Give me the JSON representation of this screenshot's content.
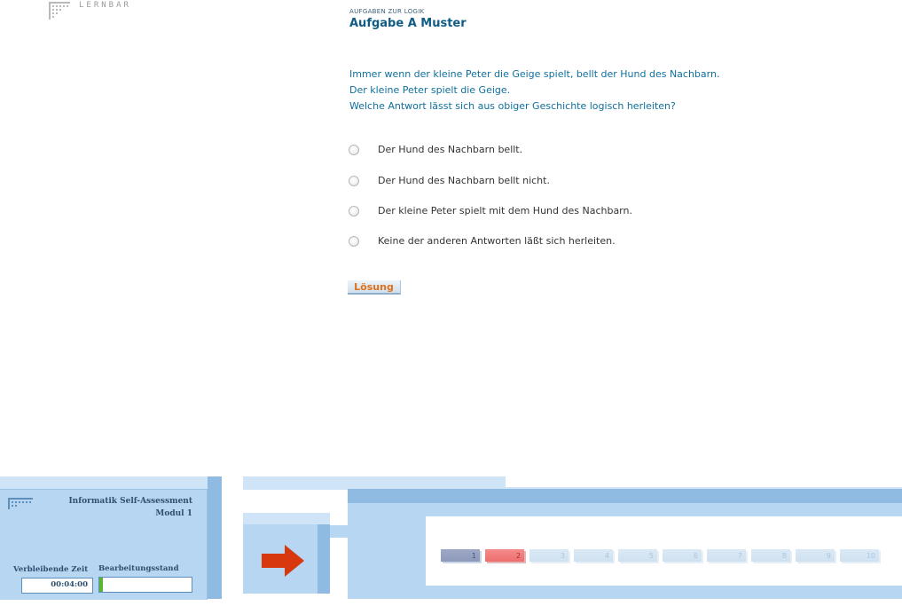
{
  "logo": {
    "text": "LERNBAR",
    "icon": "dot-matrix-logo-icon"
  },
  "task": {
    "kicker": "AUFGABEN ZUR LOGIK",
    "title": "Aufgabe A Muster",
    "prompt": [
      "Immer wenn der kleine Peter die Geige spielt, bellt der Hund des Nachbarn.",
      "Der kleine Peter spielt die Geige.",
      "Welche Antwort lässt sich aus obiger Geschichte logisch herleiten?"
    ],
    "options": [
      "Der Hund des Nachbarn bellt.",
      "Der Hund des Nachbarn bellt nicht.",
      "Der kleine Peter spielt mit dem Hund des Nachbarn.",
      "Keine der anderen Antworten läßt sich herleiten."
    ],
    "solution_label": "Lösung"
  },
  "panel": {
    "title_line1": "Informatik Self-Assessment",
    "title_line2": "Modul 1",
    "time_label": "Verbleibende Zeit",
    "time_value": "00:04:00",
    "progress_label": "Bearbeitungsstand",
    "progress_fraction": 0.04,
    "next_icon": "right-arrow-icon",
    "accent_color": "#d8380e"
  },
  "pages": [
    {
      "label": "1",
      "state": "visited"
    },
    {
      "label": "2",
      "state": "current"
    },
    {
      "label": "3",
      "state": "idle"
    },
    {
      "label": "4",
      "state": "idle"
    },
    {
      "label": "5",
      "state": "idle"
    },
    {
      "label": "6",
      "state": "idle"
    },
    {
      "label": "7",
      "state": "idle"
    },
    {
      "label": "8",
      "state": "idle"
    },
    {
      "label": "9",
      "state": "idle"
    },
    {
      "label": "10",
      "state": "idle"
    }
  ]
}
